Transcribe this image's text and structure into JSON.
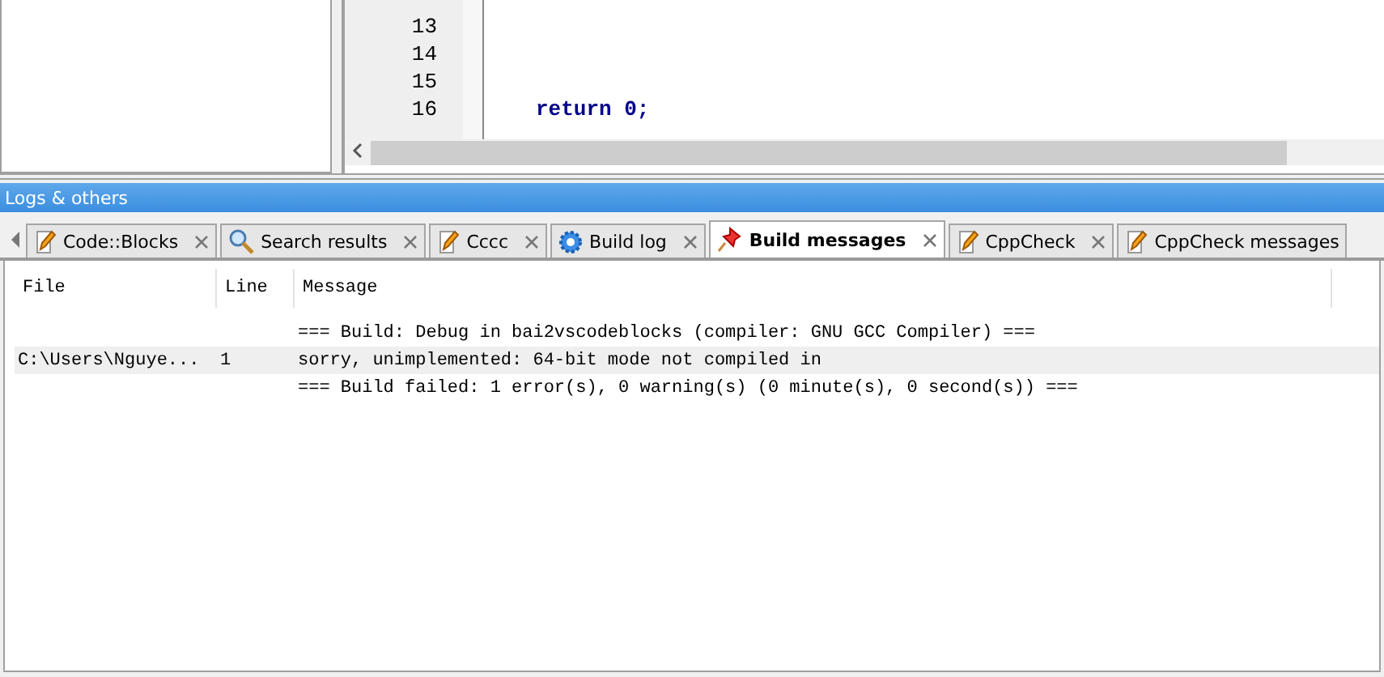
{
  "editor": {
    "lines": [
      {
        "number": "13"
      },
      {
        "number": "14"
      },
      {
        "number": "15"
      },
      {
        "number": "16",
        "code": "return 0;",
        "kind": "return"
      }
    ]
  },
  "panel": {
    "title": "Logs & others"
  },
  "tabs": [
    {
      "label": "Code::Blocks",
      "kind": "pencil",
      "selected": false
    },
    {
      "label": "Search results",
      "kind": "search",
      "selected": false
    },
    {
      "label": "Cccc",
      "kind": "pencil",
      "selected": false
    },
    {
      "label": "Build log",
      "kind": "gear",
      "selected": false
    },
    {
      "label": "Build messages",
      "kind": "pin",
      "selected": true
    },
    {
      "label": "CppCheck",
      "kind": "pencil",
      "selected": false
    },
    {
      "label": "CppCheck messages",
      "kind": "pencil",
      "selected": false
    }
  ],
  "table": {
    "columns": [
      "File",
      "Line",
      "Message"
    ],
    "rows": [
      {
        "message": "=== Build: Debug in bai2vscodeblocks (compiler: GNU GCC Compiler) ===",
        "selected": false
      },
      {
        "file": "C:\\Users\\Nguye...",
        "line": "1",
        "message": "sorry, unimplemented: 64-bit mode not compiled in",
        "selected": true
      },
      {
        "message": "=== Build failed: 1 error(s), 0 warning(s) (0 minute(s), 0 second(s)) ===",
        "selected": false
      }
    ]
  }
}
